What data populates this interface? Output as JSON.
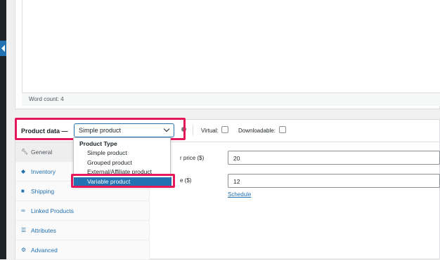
{
  "editor": {
    "word_count": "Word count: 4"
  },
  "product_data": {
    "label": "Product data —",
    "selected_type": "Simple product",
    "virtual_label": "Virtual:",
    "downloadable_label": "Downloadable:"
  },
  "tabs": [
    {
      "label": "General",
      "icon": "wrench-icon"
    },
    {
      "label": "Inventory",
      "icon": "tag-icon"
    },
    {
      "label": "Shipping",
      "icon": "truck-icon"
    },
    {
      "label": "Linked Products",
      "icon": "link-icon"
    },
    {
      "label": "Attributes",
      "icon": "list-icon"
    },
    {
      "label": "Advanced",
      "icon": "gear-icon"
    }
  ],
  "fields": {
    "regular_price_label": "r price ($)",
    "regular_price_value": "20",
    "sale_price_label": "e ($)",
    "sale_price_value": "12",
    "schedule_link": "Schedule"
  },
  "dropdown": {
    "group_label": "Product Type",
    "options": [
      "Simple product",
      "Grouped product",
      "External/Affiliate product",
      "Variable product"
    ],
    "highlighted_option": "Variable product"
  },
  "colors": {
    "accent": "#2271b1",
    "highlight": "#e5185a"
  }
}
